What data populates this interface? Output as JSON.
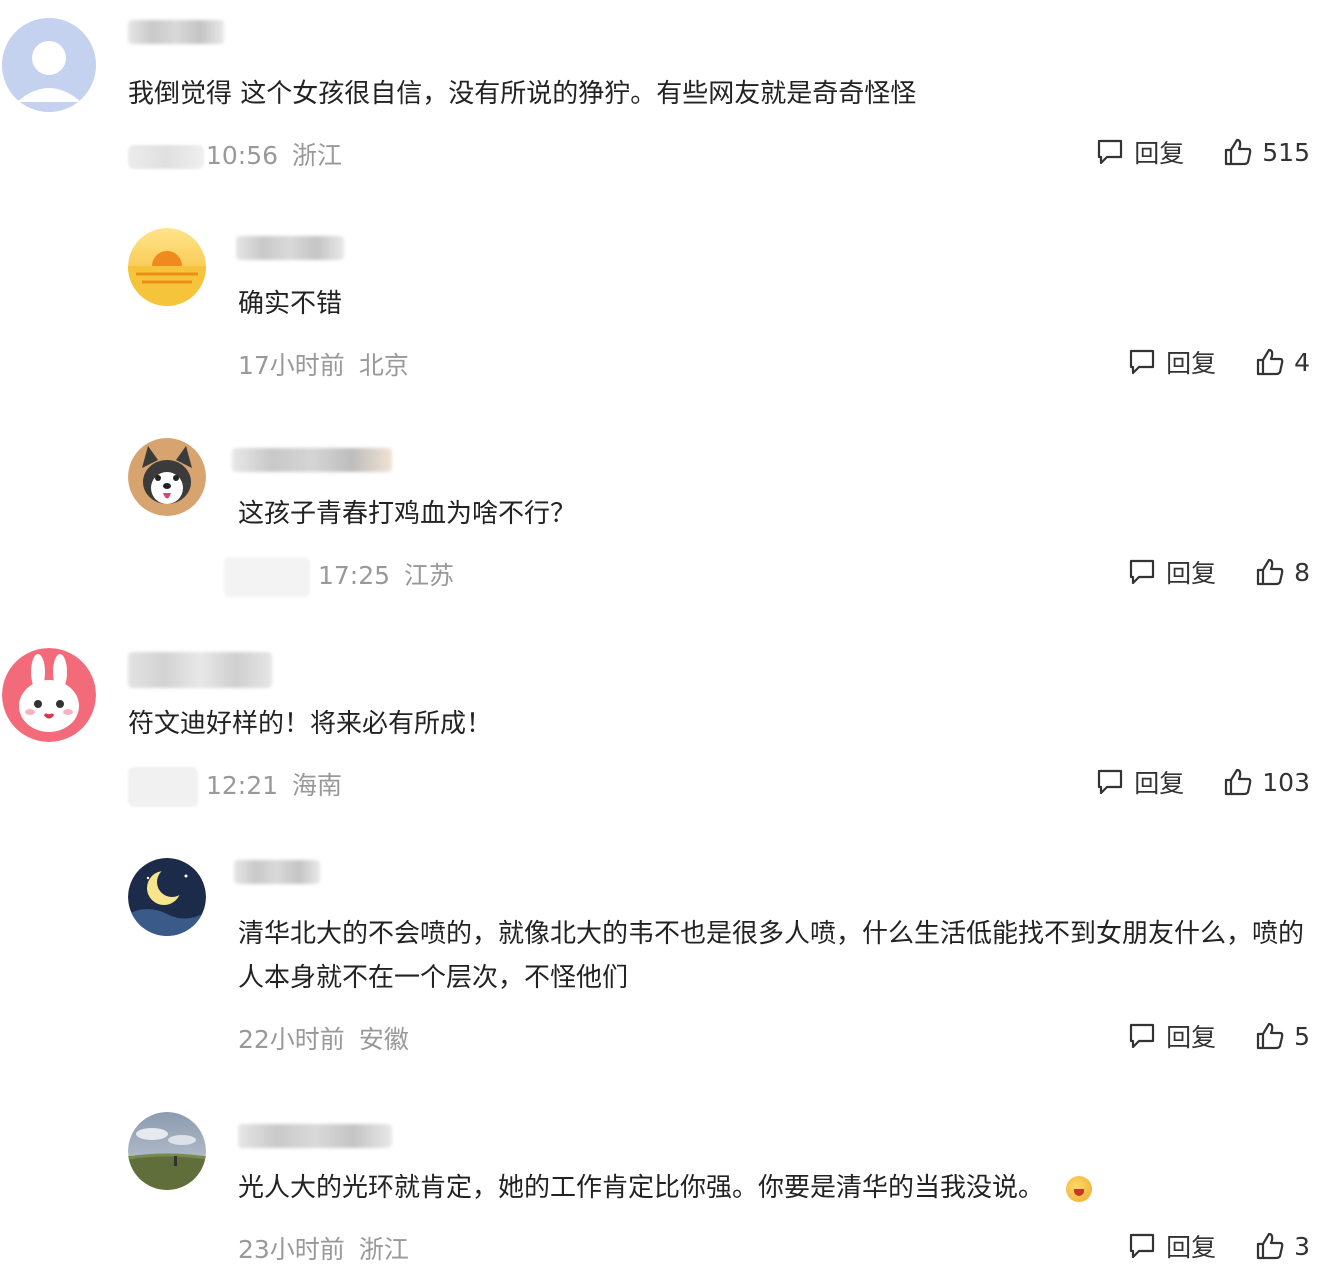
{
  "actions": {
    "reply_label": "回复"
  },
  "comments": [
    {
      "text": "我倒觉得 这个女孩很自信，没有所说的狰狞。有些网友就是奇奇怪怪",
      "time": "10:56",
      "location": "浙江",
      "likes": "515"
    },
    {
      "text": "确实不错",
      "time": "17小时前",
      "location": "北京",
      "likes": "4"
    },
    {
      "text": "这孩子青春打鸡血为啥不行？",
      "time": "17:25",
      "location": "江苏",
      "likes": "8"
    },
    {
      "text": "符文迪好样的！将来必有所成！",
      "time": "12:21",
      "location": "海南",
      "likes": "103"
    },
    {
      "text": "清华北大的不会喷的，就像北大的韦不也是很多人喷，什么生活低能找不到女朋友什么，喷的人本身就不在一个层次，不怪他们",
      "time": "22小时前",
      "location": "安徽",
      "likes": "5"
    },
    {
      "text": "光人大的光环就肯定，她的工作肯定比你强。你要是清华的当我没说。",
      "time": "23小时前",
      "location": "浙江",
      "likes": "3"
    }
  ]
}
